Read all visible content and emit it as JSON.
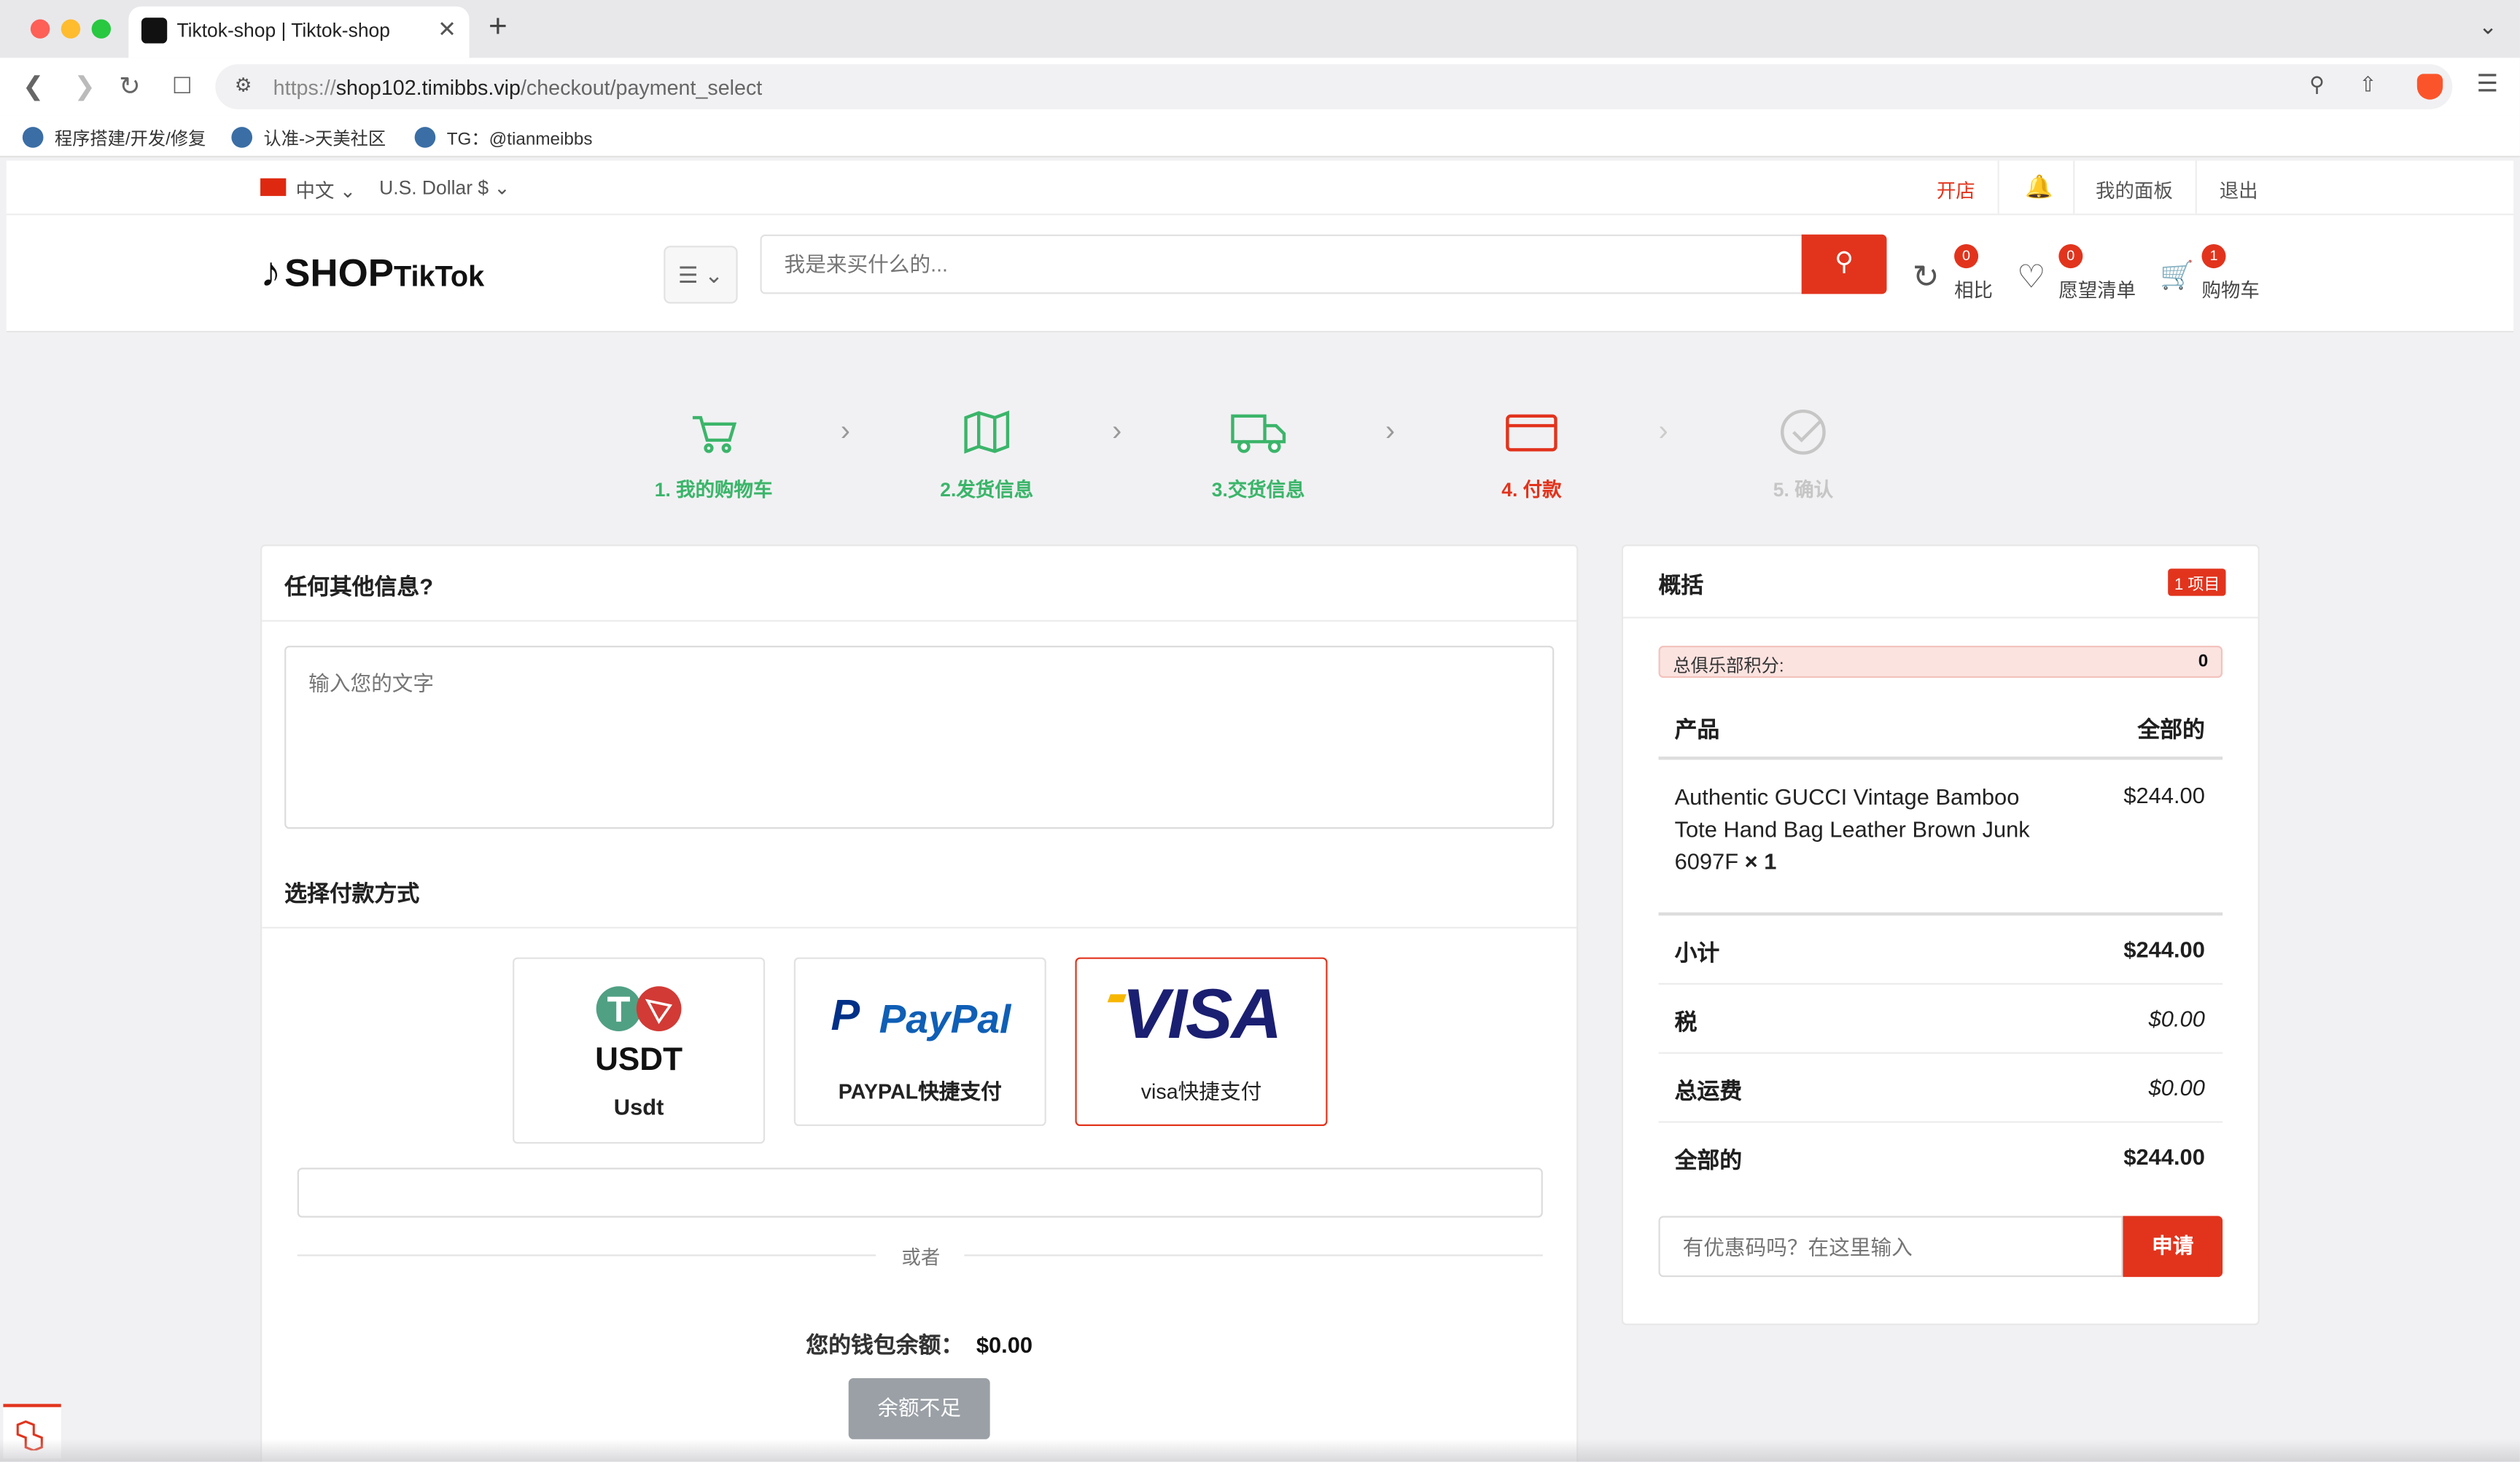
{
  "browser": {
    "tab_title": "Tiktok-shop | Tiktok-shop",
    "tab_close": "✕",
    "new_tab": "+",
    "tab_menu": "⌄",
    "url_scheme": "https://",
    "url_host": "shop102.timibbs.vip",
    "url_path": "/checkout/payment_select",
    "bookmarks": [
      "程序搭建/开发/修复",
      "认准->天美社区",
      "TG：@tianmeibbs"
    ]
  },
  "topbar": {
    "language": "中文",
    "currency": "U.S. Dollar $",
    "open_shop": "开店",
    "dashboard": "我的面板",
    "logout": "退出"
  },
  "header": {
    "logo_main": "SHOP",
    "logo_sub": "TikTok",
    "search_placeholder": "我是来买什么的...",
    "compare": {
      "label": "相比",
      "count": "0"
    },
    "wishlist": {
      "label": "愿望清单",
      "count": "0"
    },
    "cart": {
      "label": "购物车",
      "count": "1"
    }
  },
  "steps": [
    {
      "label": "1. 我的购物车",
      "state": "done"
    },
    {
      "label": "2.发货信息",
      "state": "done"
    },
    {
      "label": "3.交货信息",
      "state": "done"
    },
    {
      "label": "4. 付款",
      "state": "active"
    },
    {
      "label": "5. 确认",
      "state": "pending"
    }
  ],
  "colors": {
    "done": "#3bb56a",
    "active": "#e2341d",
    "pending": "#c6c6c6",
    "accent": "#e2341d"
  },
  "checkout": {
    "info_title": "任何其他信息?",
    "info_placeholder": "输入您的文字",
    "payment_title": "选择付款方式",
    "methods": [
      {
        "logo": "USDT",
        "label": "Usdt",
        "selected": false
      },
      {
        "logo": "PayPal",
        "label": "PAYPAL快捷支付",
        "selected": false
      },
      {
        "logo": "VISA",
        "label": "visa快捷支付",
        "selected": true
      }
    ],
    "or": "或者",
    "wallet_label": "您的钱包余额：",
    "wallet_amount": "$0.00",
    "insufficient": "余额不足"
  },
  "summary": {
    "title": "概括",
    "items_badge": "1 项目",
    "club_points_label": "总俱乐部积分:",
    "club_points": "0",
    "col_product": "产品",
    "col_total": "全部的",
    "product_name": "Authentic GUCCI Vintage Bamboo Tote Hand Bag Leather Brown Junk 6097F",
    "product_qty": "× 1",
    "product_price": "$244.00",
    "subtotal_label": "小计",
    "subtotal": "$244.00",
    "tax_label": "税",
    "tax": "$0.00",
    "shipping_label": "总运费",
    "shipping": "$0.00",
    "total_label": "全部的",
    "total": "$244.00",
    "coupon_placeholder": "有优惠码吗？在这里输入",
    "apply": "申请"
  }
}
